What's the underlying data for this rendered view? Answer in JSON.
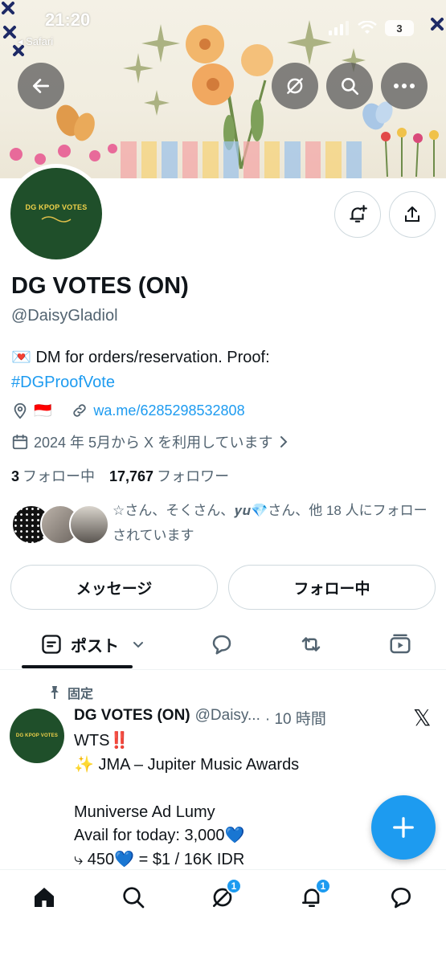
{
  "status_bar": {
    "time": "21:20",
    "back_app": "◂ Safari",
    "battery": "3"
  },
  "profile": {
    "avatar_text": "DG KPOP VOTES",
    "display_name": "DG VOTES (ON)",
    "handle": "@DaisyGladiol",
    "bio_prefix": "💌 DM for orders/reservation. Proof:",
    "bio_hashtag": "#DGProofVote",
    "location_flag": "🇮🇩",
    "website": "wa.me/6285298532808",
    "joined": "2024 年 5月から X を利用しています",
    "following_count": "3",
    "following_label": "フォロー中",
    "followers_count": "17,767",
    "followers_label": "フォロワー",
    "followed_by": "☆さん、そくさん、𝒚𝒖💎さん、他 18 人にフォローされています"
  },
  "actions": {
    "message_label": "メッセージ",
    "following_button_label": "フォロー中"
  },
  "tabs": {
    "posts_label": "ポスト"
  },
  "pinned_tweet": {
    "pinned_label": "固定",
    "name": "DG VOTES (ON)",
    "handle": "@Daisy...",
    "time": "· 10 時間",
    "avatar_text": "DG KPOP VOTES",
    "body": "WTS‼️\n✨ JMA – Jupiter Music Awards\n\nMuniverse Ad Lumy\nAvail for today: 3,000💙\n⤷ 450💙 = $1 / 16K IDR"
  },
  "bottom_nav": {
    "communities_badge": "1",
    "notifications_badge": "1"
  },
  "colors": {
    "accent": "#1d9bf0",
    "avatar_bg": "#1f4f2a",
    "secondary_text": "#536471"
  }
}
